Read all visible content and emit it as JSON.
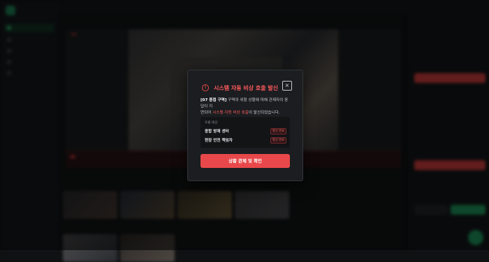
{
  "modal": {
    "title": "시스템 자동 비상 호출 발신",
    "body_bold": "[07 용접 구역]",
    "body_text1": " 구역의 위험 상황에 대해 관제자의 응답이 지",
    "body_text2": "연되어 ",
    "body_highlight": "시스템 자동 비상 호출",
    "body_text3": "이 발신되었습니다.",
    "contacts_label": "호출 대상",
    "contacts": [
      {
        "name": "종합 방재 센터",
        "status": "발신 완료"
      },
      {
        "name": "현장 안전 책임자",
        "status": "발신 완료"
      }
    ],
    "confirm_label": "상황 관제 및 확인",
    "close_symbol": "×",
    "warning_symbol": "!"
  },
  "colors": {
    "accent_red": "#e8484a",
    "accent_green": "#1f9d60"
  }
}
